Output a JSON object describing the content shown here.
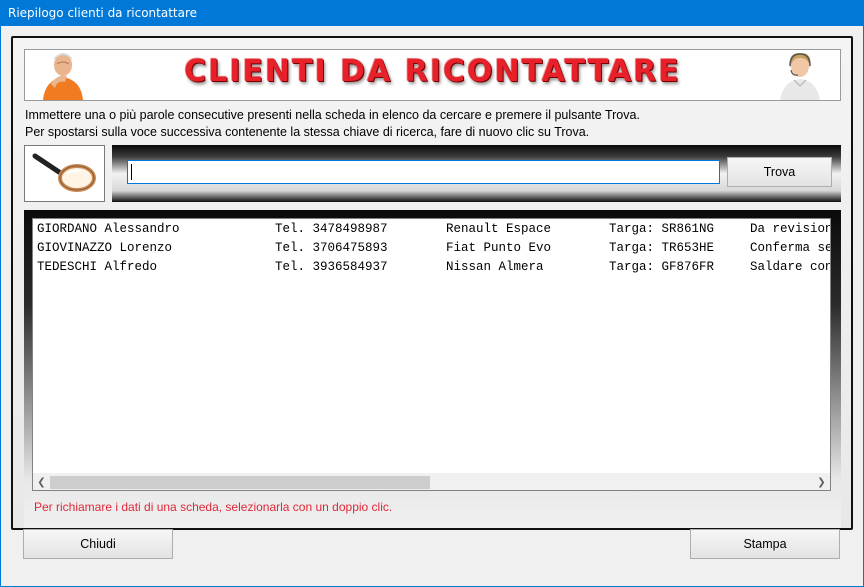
{
  "window": {
    "title": "Riepilogo clienti da ricontattare"
  },
  "banner": {
    "title": "CLIENTI DA RICONTATTARE"
  },
  "instructions": {
    "line1": "Immettere una o più parole consecutive presenti nella scheda in elenco da cercare e premere il pulsante Trova.",
    "line2": "Per spostarsi sulla voce successiva contenente la stessa chiave di ricerca, fare di nuovo clic su Trova."
  },
  "search": {
    "value": "",
    "button_label": "Trova",
    "icon": "magnifying-glass-icon"
  },
  "list": {
    "rows": [
      {
        "name": "GIORDANO Alessandro",
        "phone": "Tel. 3478498987",
        "car": "Renault Espace",
        "plate": "Targa: SR861NG",
        "note": "Da revision"
      },
      {
        "name": "GIOVINAZZO Lorenzo",
        "phone": "Tel. 3706475893",
        "car": "Fiat Punto Evo",
        "plate": "Targa: TR653HE",
        "note": "Conferma se"
      },
      {
        "name": "TEDESCHI Alfredo",
        "phone": "Tel. 3936584937",
        "car": "Nissan Almera",
        "plate": "Targa: GF876FR",
        "note": "Saldare con"
      }
    ],
    "scroll_left_icon": "chevron-left-icon",
    "scroll_right_icon": "chevron-right-icon"
  },
  "hint": "Per richiamare i dati di una scheda, selezionarla con un doppio clic.",
  "buttons": {
    "close_label": "Chiudi",
    "print_label": "Stampa"
  },
  "colors": {
    "titlebar": "#0078d7",
    "banner_text": "#e8202a",
    "hint_text": "#e0283a",
    "focus_border": "#0078d7"
  }
}
